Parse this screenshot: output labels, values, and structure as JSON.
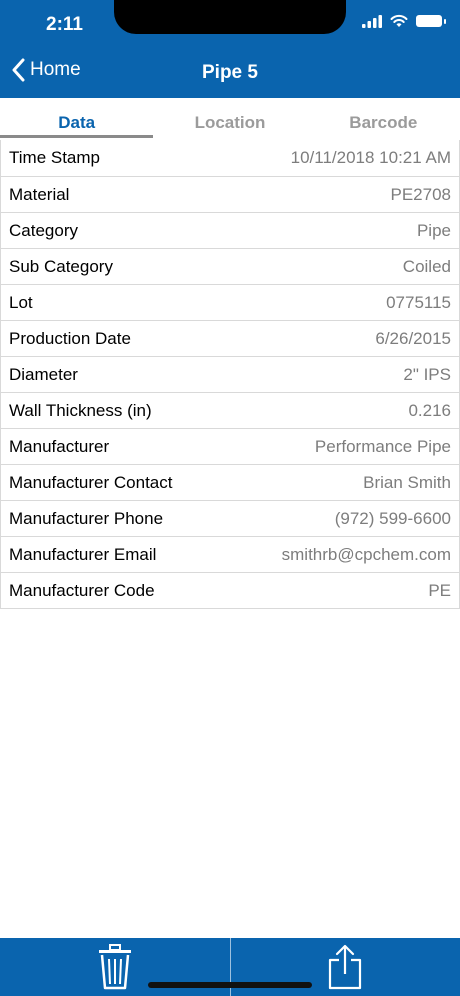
{
  "status_bar": {
    "time": "2:11"
  },
  "nav": {
    "back_label": "Home",
    "title": "Pipe 5"
  },
  "tabs": [
    {
      "label": "Data",
      "active": true
    },
    {
      "label": "Location",
      "active": false
    },
    {
      "label": "Barcode",
      "active": false
    }
  ],
  "rows": [
    {
      "label": "Time Stamp",
      "value": "10/11/2018 10:21 AM"
    },
    {
      "label": "Material",
      "value": "PE2708"
    },
    {
      "label": "Category",
      "value": "Pipe"
    },
    {
      "label": "Sub Category",
      "value": "Coiled"
    },
    {
      "label": "Lot",
      "value": "0775115"
    },
    {
      "label": "Production Date",
      "value": "6/26/2015"
    },
    {
      "label": "Diameter",
      "value": "2\" IPS"
    },
    {
      "label": "Wall Thickness (in)",
      "value": "0.216"
    },
    {
      "label": "Manufacturer",
      "value": "Performance Pipe"
    },
    {
      "label": "Manufacturer Contact",
      "value": "Brian Smith"
    },
    {
      "label": "Manufacturer Phone",
      "value": "(972) 599-6600"
    },
    {
      "label": "Manufacturer Email",
      "value": "smithrb@cpchem.com"
    },
    {
      "label": "Manufacturer Code",
      "value": "PE"
    }
  ],
  "bottom_bar": {
    "icons": [
      "trash-icon",
      "share-icon"
    ]
  },
  "colors": {
    "accent": "#0a64ae",
    "active_tab": "#0a64ae",
    "inactive_tab": "#9b9b9b",
    "value_text": "#7d7d7d"
  }
}
